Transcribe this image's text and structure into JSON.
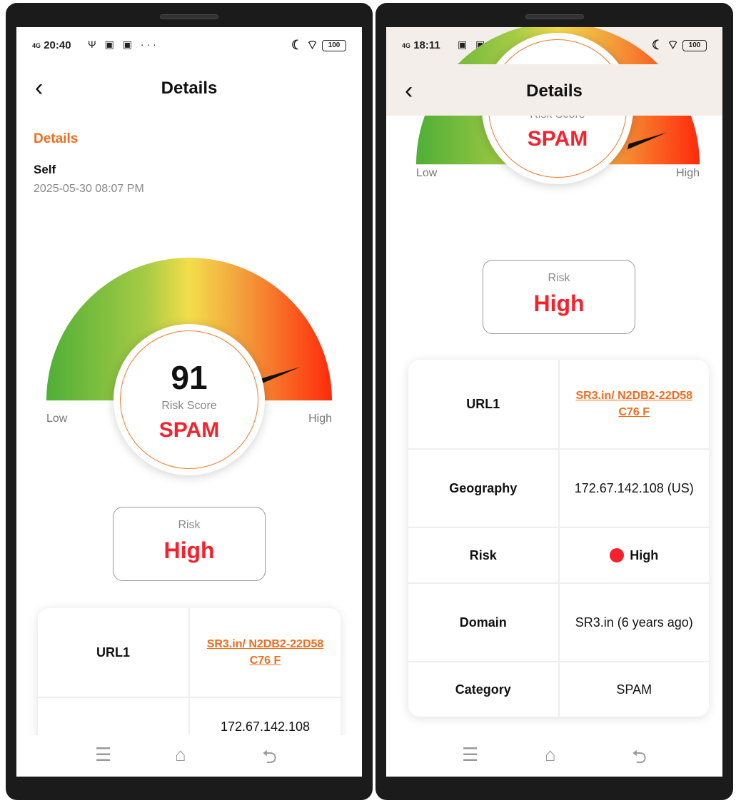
{
  "left": {
    "status": {
      "time": "20:40",
      "icons": "Ψ ▣ ▣ ···",
      "signal": "4G",
      "battery": "100"
    },
    "title": "Details",
    "section_title": "Details",
    "who": "Self",
    "when": "2025-05-30 08:07 PM",
    "score": "91",
    "score_label": "Risk Score",
    "verdict": "SPAM",
    "low": "Low",
    "high": "High",
    "risk_label": "Risk",
    "risk_value": "High",
    "rows": [
      {
        "key": "URL1",
        "value": "SR3.in/ N2DB2-22D58C76 F"
      },
      {
        "key": "Geography",
        "value": "172.67.142.108"
      }
    ]
  },
  "right": {
    "status": {
      "time": "18:11",
      "icons": "▣ ▣ Ψ ···",
      "signal": "4G",
      "battery": "100"
    },
    "title": "Details",
    "score": "91",
    "score_label": "Risk Score",
    "verdict": "SPAM",
    "low": "Low",
    "high": "High",
    "risk_label": "Risk",
    "risk_value": "High",
    "rows": [
      {
        "key": "URL1",
        "value": "SR3.in/ N2DB2-22D58C76 F"
      },
      {
        "key": "Geography",
        "value": "172.67.142.108 (US)"
      },
      {
        "key": "Risk",
        "value": "High"
      },
      {
        "key": "Domain",
        "value": "SR3.in (6 years ago)"
      },
      {
        "key": "Category",
        "value": "SPAM"
      }
    ]
  },
  "nav": {
    "menu_icon": "menu-icon",
    "home_icon": "home-icon",
    "back_icon": "back-icon"
  },
  "colors": {
    "accent": "#f26b1d",
    "danger": "#f5222d",
    "gauge_low": "#5bb53a",
    "gauge_mid": "#f2dd4c",
    "gauge_high": "#ff2a0a"
  }
}
